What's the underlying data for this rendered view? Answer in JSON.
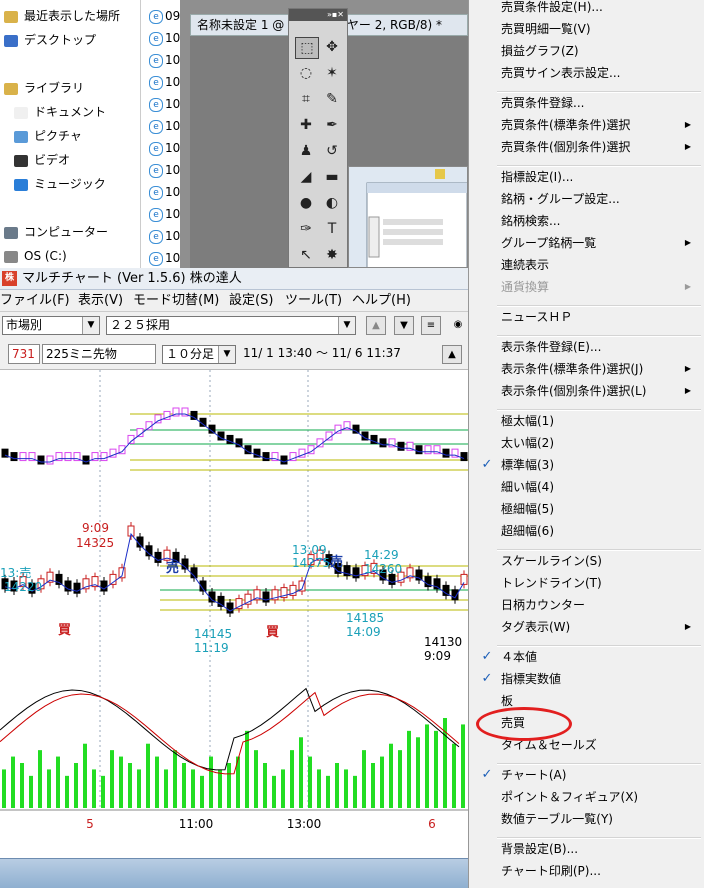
{
  "explorer": {
    "nav_items": [
      "最近表示した場所",
      "デスクトップ",
      "ライブラリ",
      "ドキュメント",
      "ピクチャ",
      "ビデオ",
      "ミュージック",
      "コンピューター",
      "OS (C:)"
    ],
    "file_rows": [
      "09",
      "10",
      "10",
      "10",
      "10",
      "10",
      "10",
      "10",
      "10",
      "10",
      "10",
      "10"
    ]
  },
  "photoshop": {
    "doc_title": "名称未設定 1 @ 50% (レイヤー 2, RGB/8) *",
    "tool_icons": [
      "rect-marquee-icon",
      "move-icon",
      "lasso-icon",
      "magic-wand-icon",
      "crop-icon",
      "eyedropper-icon",
      "healing-icon",
      "brush-icon",
      "stamp-icon",
      "history-brush-icon",
      "eraser-icon",
      "gradient-icon",
      "blur-icon",
      "dodge-icon",
      "pen-icon",
      "type-icon",
      "path-select-icon",
      "shape-icon"
    ]
  },
  "app": {
    "title": "マルチチャート (Ver 1.5.6)  株の達人",
    "menus": [
      "ファイル(F)",
      "表示(V)",
      "モード切替(M)",
      "設定(S)",
      "ツール(T)",
      "ヘルプ(H)"
    ],
    "market_select": "市場別",
    "index_select": "２２５採用",
    "code": "731",
    "symbol": "225ミニ先物",
    "interval_select": "１０分足",
    "date_range": "11/ 1 13:40 ～ 11/ 6 11:37"
  },
  "chart_data": {
    "type": "line",
    "title": "",
    "x_tick_labels": [
      "5",
      "11:00",
      "13:00",
      "6"
    ],
    "annotations": [
      {
        "text": "9:09",
        "color": "#c81e1e"
      },
      {
        "text": "14325",
        "color": "#c81e1e"
      },
      {
        "text": "13:09",
        "color": "#1aa0b8"
      },
      {
        "text": "14275",
        "color": "#1aa0b8"
      },
      {
        "text": "14:29",
        "color": "#1aa0b8"
      },
      {
        "text": "14260",
        "color": "#1aa0b8"
      },
      {
        "text": "13:売",
        "color": "#1aa0b8"
      },
      {
        "text": "14220",
        "color": "#1aa0b8"
      },
      {
        "text": "14145",
        "color": "#1aa0b8"
      },
      {
        "text": "11:19",
        "color": "#1aa0b8"
      },
      {
        "text": "14185",
        "color": "#1aa0b8"
      },
      {
        "text": "14:09",
        "color": "#1aa0b8"
      },
      {
        "text": "14130",
        "color": "#000000"
      },
      {
        "text": "9:09",
        "color": "#000000"
      }
    ],
    "trade_marks": [
      {
        "text": "売",
        "color": "#1c3fa8"
      },
      {
        "text": "売",
        "color": "#1c3fa8"
      },
      {
        "text": "買",
        "color": "#c81e1e"
      },
      {
        "text": "買",
        "color": "#c81e1e"
      }
    ],
    "upper_series": [
      1462,
      1461,
      1461,
      1461,
      1460,
      1460,
      1461,
      1461,
      1461,
      1460,
      1461,
      1461,
      1462,
      1463,
      1466,
      1468,
      1470,
      1472,
      1473,
      1474,
      1474,
      1473,
      1471,
      1469,
      1467,
      1466,
      1465,
      1463,
      1462,
      1461,
      1461,
      1460,
      1461,
      1462,
      1463,
      1465,
      1467,
      1469,
      1470,
      1469,
      1467,
      1466,
      1465,
      1465,
      1464,
      1464,
      1463,
      1463,
      1463,
      1462,
      1462,
      1461
    ],
    "price_series": [
      14205,
      14200,
      14210,
      14195,
      14205,
      14220,
      14215,
      14200,
      14195,
      14205,
      14210,
      14200,
      14215,
      14230,
      14325,
      14300,
      14280,
      14265,
      14270,
      14265,
      14250,
      14230,
      14200,
      14175,
      14165,
      14150,
      14160,
      14170,
      14180,
      14175,
      14180,
      14185,
      14190,
      14200,
      14260,
      14270,
      14260,
      14240,
      14235,
      14230,
      14235,
      14240,
      14225,
      14215,
      14220,
      14230,
      14225,
      14210,
      14205,
      14190,
      14180,
      14215
    ],
    "volume_series": [
      6,
      8,
      7,
      5,
      9,
      6,
      8,
      5,
      7,
      10,
      6,
      5,
      9,
      8,
      7,
      6,
      10,
      8,
      6,
      9,
      7,
      6,
      5,
      8,
      6,
      7,
      8,
      12,
      9,
      7,
      5,
      6,
      9,
      11,
      8,
      6,
      5,
      7,
      6,
      5,
      9,
      7,
      8,
      10,
      9,
      12,
      11,
      13,
      12,
      14,
      10,
      13
    ],
    "colors": {
      "up": "#d946ef",
      "down": "#000000",
      "ma_fast": "#1c2fc8",
      "ma_slow": "#0ca84a",
      "band": "#b8b800",
      "volume": "#22dd22",
      "osc1": "#000000",
      "osc2": "#cc0000"
    }
  },
  "context_menu": {
    "items": [
      {
        "label": "売買条件設定(H)..."
      },
      {
        "label": "売買明細一覧(V)"
      },
      {
        "label": "損益グラフ(Z)"
      },
      {
        "label": "売買サイン表示設定..."
      },
      {
        "sep": true
      },
      {
        "label": "売買条件登録..."
      },
      {
        "label": "売買条件(標準条件)選択",
        "sub": true
      },
      {
        "label": "売買条件(個別条件)選択",
        "sub": true
      },
      {
        "sep": true
      },
      {
        "label": "指標設定(I)..."
      },
      {
        "label": "銘柄・グループ設定..."
      },
      {
        "label": "銘柄検索..."
      },
      {
        "label": "グループ銘柄一覧",
        "sub": true
      },
      {
        "label": "連続表示"
      },
      {
        "label": "通貨換算",
        "sub": true,
        "disabled": true
      },
      {
        "sep": true
      },
      {
        "label": "ニュースＨＰ"
      },
      {
        "sep": true
      },
      {
        "label": "表示条件登録(E)..."
      },
      {
        "label": "表示条件(標準条件)選択(J)",
        "sub": true
      },
      {
        "label": "表示条件(個別条件)選択(L)",
        "sub": true
      },
      {
        "sep": true
      },
      {
        "label": "極太幅(1)"
      },
      {
        "label": "太い幅(2)"
      },
      {
        "label": "標準幅(3)",
        "checked": true
      },
      {
        "label": "細い幅(4)"
      },
      {
        "label": "極細幅(5)"
      },
      {
        "label": "超細幅(6)"
      },
      {
        "sep": true
      },
      {
        "label": "スケールライン(S)"
      },
      {
        "label": "トレンドライン(T)"
      },
      {
        "label": "日柄カウンター"
      },
      {
        "label": "タグ表示(W)",
        "sub": true
      },
      {
        "sep": true
      },
      {
        "label": "４本値",
        "checked": true
      },
      {
        "label": "指標実数値",
        "checked": true
      },
      {
        "label": "板"
      },
      {
        "label": "売買",
        "highlighted": true
      },
      {
        "label": "タイム＆セールズ"
      },
      {
        "sep": true
      },
      {
        "label": "チャート(A)",
        "checked": true
      },
      {
        "label": "ポイント＆フィギュア(X)"
      },
      {
        "label": "数値テーブル一覧(Y)"
      },
      {
        "sep": true
      },
      {
        "label": "背景設定(B)..."
      },
      {
        "label": "チャート印刷(P)..."
      }
    ]
  }
}
